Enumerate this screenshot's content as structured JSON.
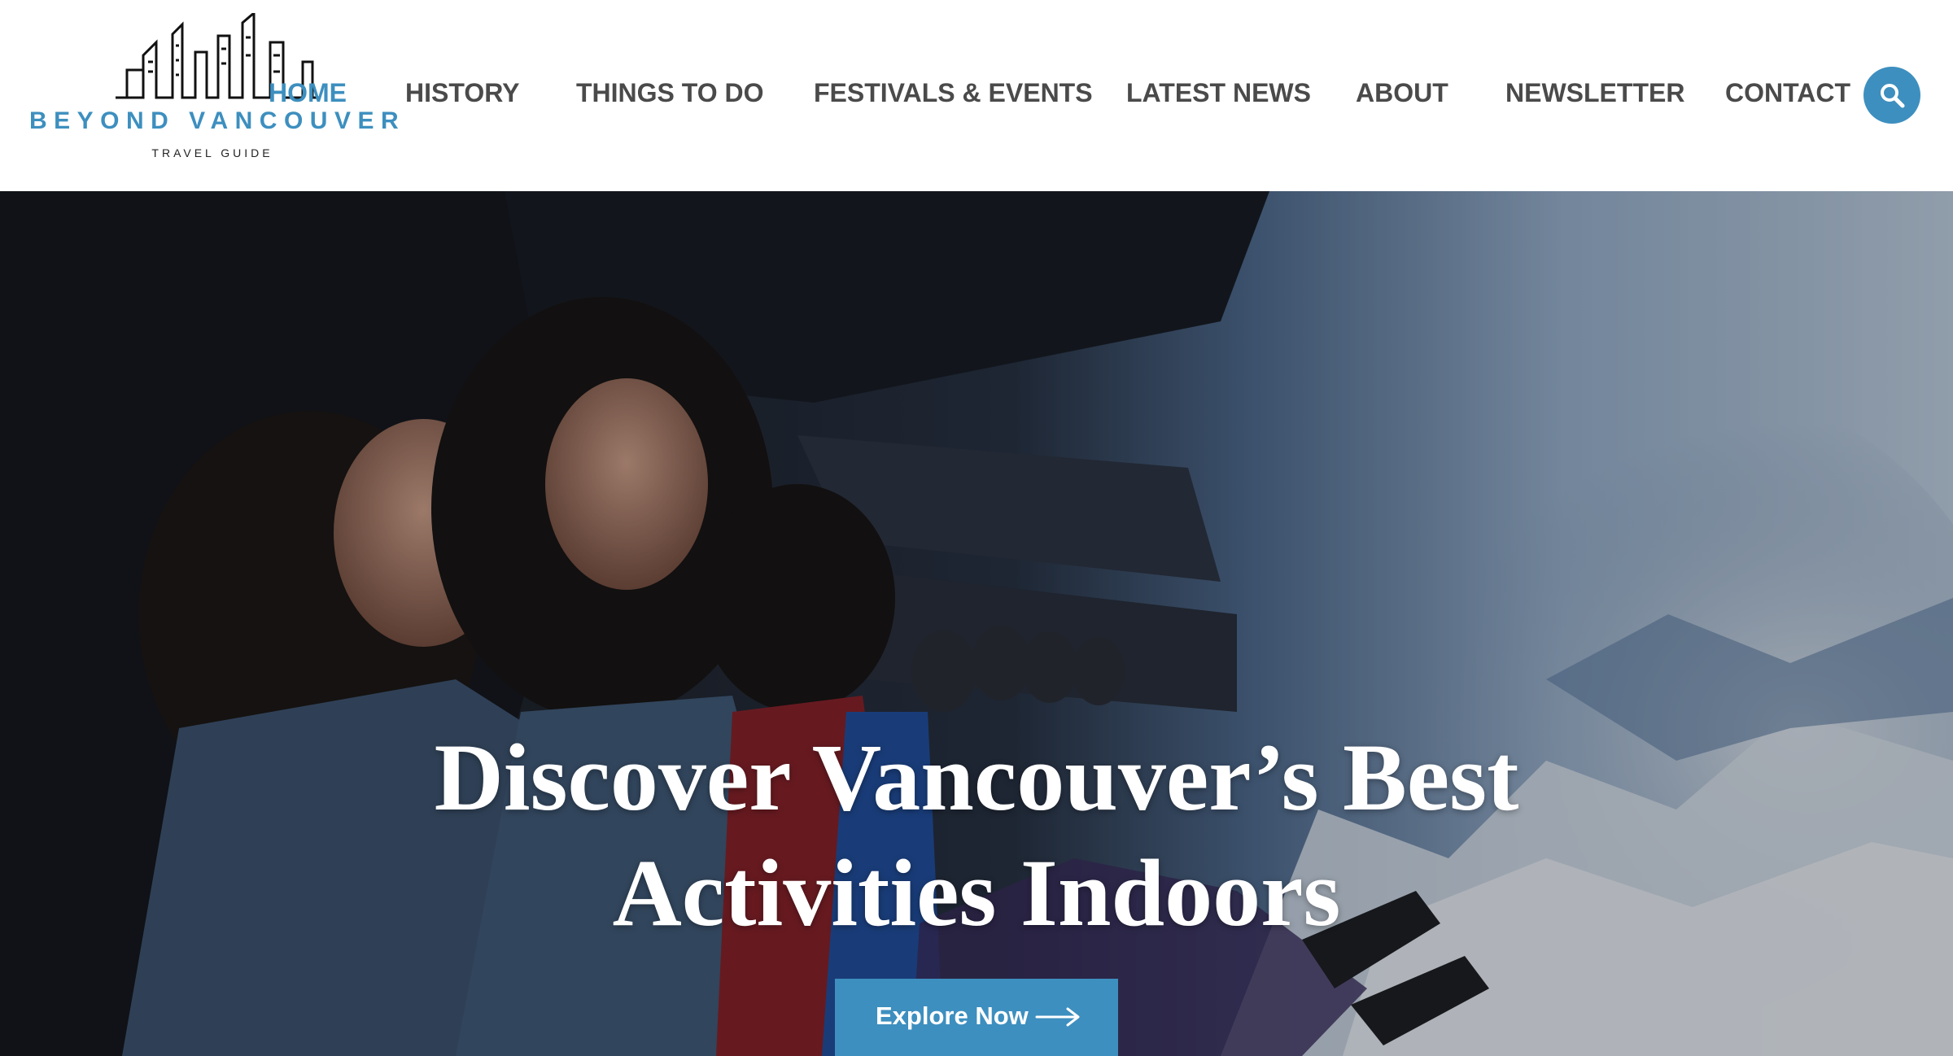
{
  "brand": {
    "name": "BEYOND VANCOUVER",
    "tagline": "TRAVEL GUIDE",
    "accent_color": "#3d8fbf",
    "logo_icon": "city-skyline-icon"
  },
  "nav": {
    "items": [
      {
        "label": "HOME",
        "active": true
      },
      {
        "label": "HISTORY",
        "active": false
      },
      {
        "label": "THINGS TO DO",
        "active": false
      },
      {
        "label": "FESTIVALS & EVENTS",
        "active": false
      },
      {
        "label": "LATEST NEWS",
        "active": false
      },
      {
        "label": "ABOUT",
        "active": false
      },
      {
        "label": "NEWSLETTER",
        "active": false
      },
      {
        "label": "CONTACT",
        "active": false
      }
    ],
    "search_icon": "search-icon"
  },
  "hero": {
    "title_line1": "Discover Vancouver’s Best",
    "title_line2": "Activities Indoors",
    "button_label": "Explore Now",
    "button_icon": "arrow-right-icon"
  }
}
